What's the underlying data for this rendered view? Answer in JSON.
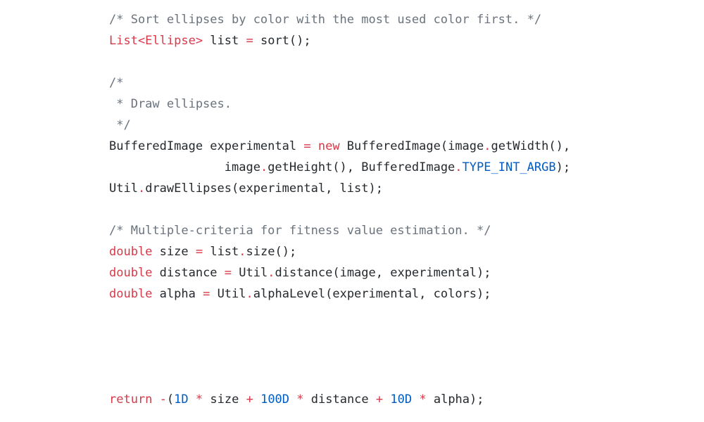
{
  "code": {
    "lines": [
      {
        "tokens": [
          {
            "t": "/* Sort ellipses by color with the most used color first. */",
            "c": "comment"
          }
        ]
      },
      {
        "tokens": [
          {
            "t": "List<Ellipse>",
            "c": "kw"
          },
          {
            "t": " list ",
            "c": ""
          },
          {
            "t": "=",
            "c": "op"
          },
          {
            "t": " sort();",
            "c": ""
          }
        ]
      },
      {
        "tokens": [
          {
            "t": "/*",
            "c": "comment"
          }
        ]
      },
      {
        "tokens": [
          {
            "t": " * Draw ellipses.",
            "c": "comment"
          }
        ]
      },
      {
        "tokens": [
          {
            "t": " */",
            "c": "comment"
          }
        ]
      },
      {
        "tokens": [
          {
            "t": "BufferedImage experimental ",
            "c": ""
          },
          {
            "t": "=",
            "c": "op"
          },
          {
            "t": " ",
            "c": ""
          },
          {
            "t": "new",
            "c": "kw"
          },
          {
            "t": " BufferedImage(image",
            "c": ""
          },
          {
            "t": ".",
            "c": "op"
          },
          {
            "t": "getWidth(),",
            "c": ""
          }
        ]
      },
      {
        "tokens": [
          {
            "t": "                image",
            "c": ""
          },
          {
            "t": ".",
            "c": "op"
          },
          {
            "t": "getHeight(), BufferedImage",
            "c": ""
          },
          {
            "t": ".",
            "c": "op"
          },
          {
            "t": "TYPE_INT_ARGB",
            "c": "const"
          },
          {
            "t": ");",
            "c": ""
          }
        ]
      },
      {
        "tokens": [
          {
            "t": "Util",
            "c": ""
          },
          {
            "t": ".",
            "c": "op"
          },
          {
            "t": "drawEllipses(experimental, list);",
            "c": ""
          }
        ]
      },
      {
        "tokens": [
          {
            "t": "/* Multiple-criteria for fitness value estimation. */",
            "c": "comment"
          }
        ]
      },
      {
        "tokens": [
          {
            "t": "double",
            "c": "kw"
          },
          {
            "t": " size ",
            "c": ""
          },
          {
            "t": "=",
            "c": "op"
          },
          {
            "t": " list",
            "c": ""
          },
          {
            "t": ".",
            "c": "op"
          },
          {
            "t": "size();",
            "c": ""
          }
        ]
      },
      {
        "tokens": [
          {
            "t": "double",
            "c": "kw"
          },
          {
            "t": " distance ",
            "c": ""
          },
          {
            "t": "=",
            "c": "op"
          },
          {
            "t": " Util",
            "c": ""
          },
          {
            "t": ".",
            "c": "op"
          },
          {
            "t": "distance(image, experimental);",
            "c": ""
          }
        ]
      },
      {
        "tokens": [
          {
            "t": "double",
            "c": "kw"
          },
          {
            "t": " alpha ",
            "c": ""
          },
          {
            "t": "=",
            "c": "op"
          },
          {
            "t": " Util",
            "c": ""
          },
          {
            "t": ".",
            "c": "op"
          },
          {
            "t": "alphaLevel(experimental, colors);",
            "c": ""
          }
        ]
      },
      {
        "tokens": [
          {
            "t": "return",
            "c": "kw"
          },
          {
            "t": " ",
            "c": ""
          },
          {
            "t": "-",
            "c": "op"
          },
          {
            "t": "(",
            "c": ""
          },
          {
            "t": "1D",
            "c": "num"
          },
          {
            "t": " ",
            "c": ""
          },
          {
            "t": "*",
            "c": "op"
          },
          {
            "t": " size ",
            "c": ""
          },
          {
            "t": "+",
            "c": "op"
          },
          {
            "t": " ",
            "c": ""
          },
          {
            "t": "100D",
            "c": "num"
          },
          {
            "t": " ",
            "c": ""
          },
          {
            "t": "*",
            "c": "op"
          },
          {
            "t": " distance ",
            "c": ""
          },
          {
            "t": "+",
            "c": "op"
          },
          {
            "t": " ",
            "c": ""
          },
          {
            "t": "10D",
            "c": "num"
          },
          {
            "t": " ",
            "c": ""
          },
          {
            "t": "*",
            "c": "op"
          },
          {
            "t": " alpha);",
            "c": ""
          }
        ]
      }
    ]
  }
}
